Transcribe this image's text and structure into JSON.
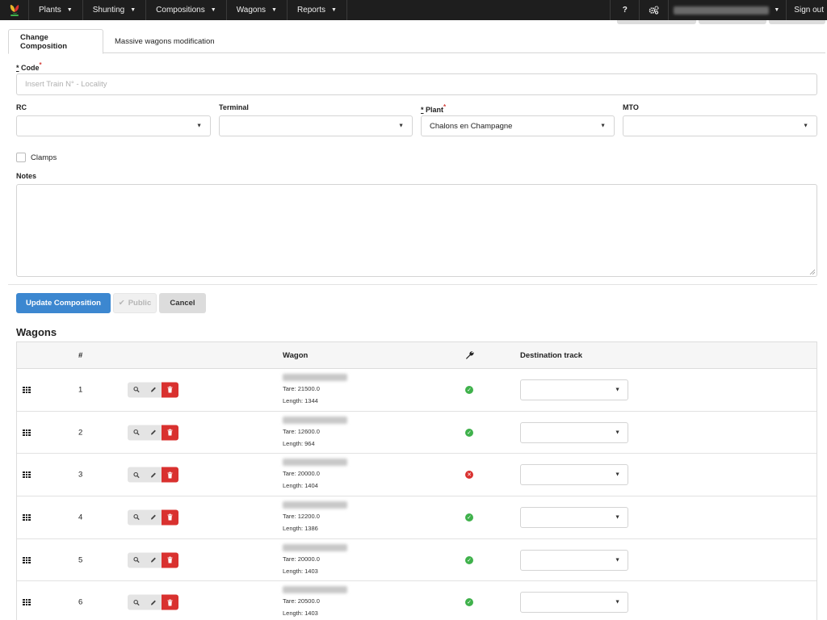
{
  "nav": {
    "logo_icon": "company-logo",
    "items": [
      {
        "label": "Plants"
      },
      {
        "label": "Shunting"
      },
      {
        "label": "Compositions"
      },
      {
        "label": "Wagons"
      },
      {
        "label": "Reports"
      }
    ],
    "help_label": "?",
    "settings_icon": "gears-icon",
    "signout_label": "Sign out"
  },
  "tabs": [
    {
      "label": "Change Composition",
      "active": true
    },
    {
      "label": "Massive wagons modification",
      "active": false
    }
  ],
  "form": {
    "code": {
      "label_prefix": "*",
      "label": "Code",
      "required_mark": "*",
      "placeholder": "Insert Train N° - Locality",
      "value": ""
    },
    "rc": {
      "label": "RC",
      "value": ""
    },
    "terminal": {
      "label": "Terminal",
      "value": ""
    },
    "plant": {
      "label_prefix": "*",
      "label": "Plant",
      "required_mark": "*",
      "value": "Chalons en Champagne"
    },
    "mto": {
      "label": "MTO",
      "value": ""
    },
    "clamps": {
      "label": "Clamps",
      "checked": false
    },
    "notes": {
      "label": "Notes",
      "value": ""
    }
  },
  "buttons": {
    "update": "Update Composition",
    "public": "Public",
    "cancel": "Cancel"
  },
  "wagons": {
    "title": "Wagons",
    "columns": {
      "num": "#",
      "wagon": "Wagon",
      "dest": "Destination track",
      "tool_icon": "wrench-icon"
    },
    "rows": [
      {
        "num": "1",
        "tare": "Tare: 21500.0",
        "length": "Length: 1344",
        "status": "ok"
      },
      {
        "num": "2",
        "tare": "Tare: 12600.0",
        "length": "Length: 964",
        "status": "ok"
      },
      {
        "num": "3",
        "tare": "Tare: 20000.0",
        "length": "Length: 1404",
        "status": "error"
      },
      {
        "num": "4",
        "tare": "Tare: 12200.0",
        "length": "Length: 1386",
        "status": "ok"
      },
      {
        "num": "5",
        "tare": "Tare: 20000.0",
        "length": "Length: 1403",
        "status": "ok"
      },
      {
        "num": "6",
        "tare": "Tare: 20500.0",
        "length": "Length: 1403",
        "status": "ok"
      }
    ]
  },
  "colors": {
    "navbar": "#1e1e1e",
    "primary": "#3c87d0",
    "danger": "#d9312f",
    "success": "#3fb14b"
  }
}
